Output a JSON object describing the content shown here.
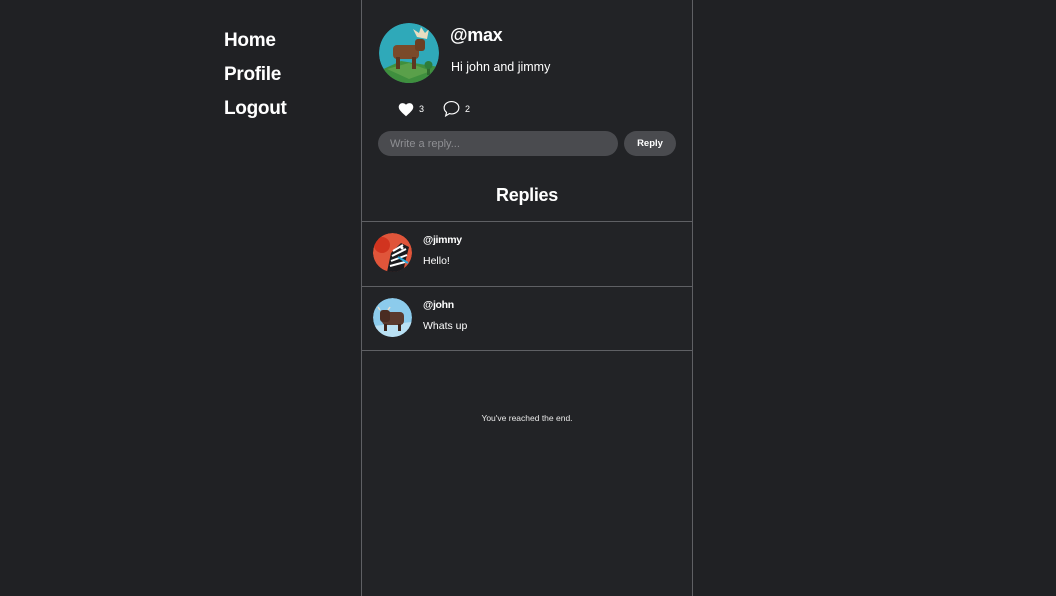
{
  "nav": {
    "items": [
      {
        "label": "Home"
      },
      {
        "label": "Profile"
      },
      {
        "label": "Logout"
      }
    ]
  },
  "post": {
    "author": "@max",
    "text": "Hi john and jimmy",
    "likes": "3",
    "comments": "2",
    "like_icon": "heart-icon",
    "comment_icon": "speech-bubble-icon"
  },
  "reply_form": {
    "placeholder": "Write a reply...",
    "button_label": "Reply"
  },
  "replies": {
    "title": "Replies",
    "items": [
      {
        "author": "@jimmy",
        "text": "Hello!"
      },
      {
        "author": "@john",
        "text": "Whats up"
      }
    ],
    "end_text": "You've reached the end."
  },
  "colors": {
    "background": "#202124",
    "divider": "#5f6064",
    "input": "#4a4b4f",
    "text": "#ffffff"
  }
}
